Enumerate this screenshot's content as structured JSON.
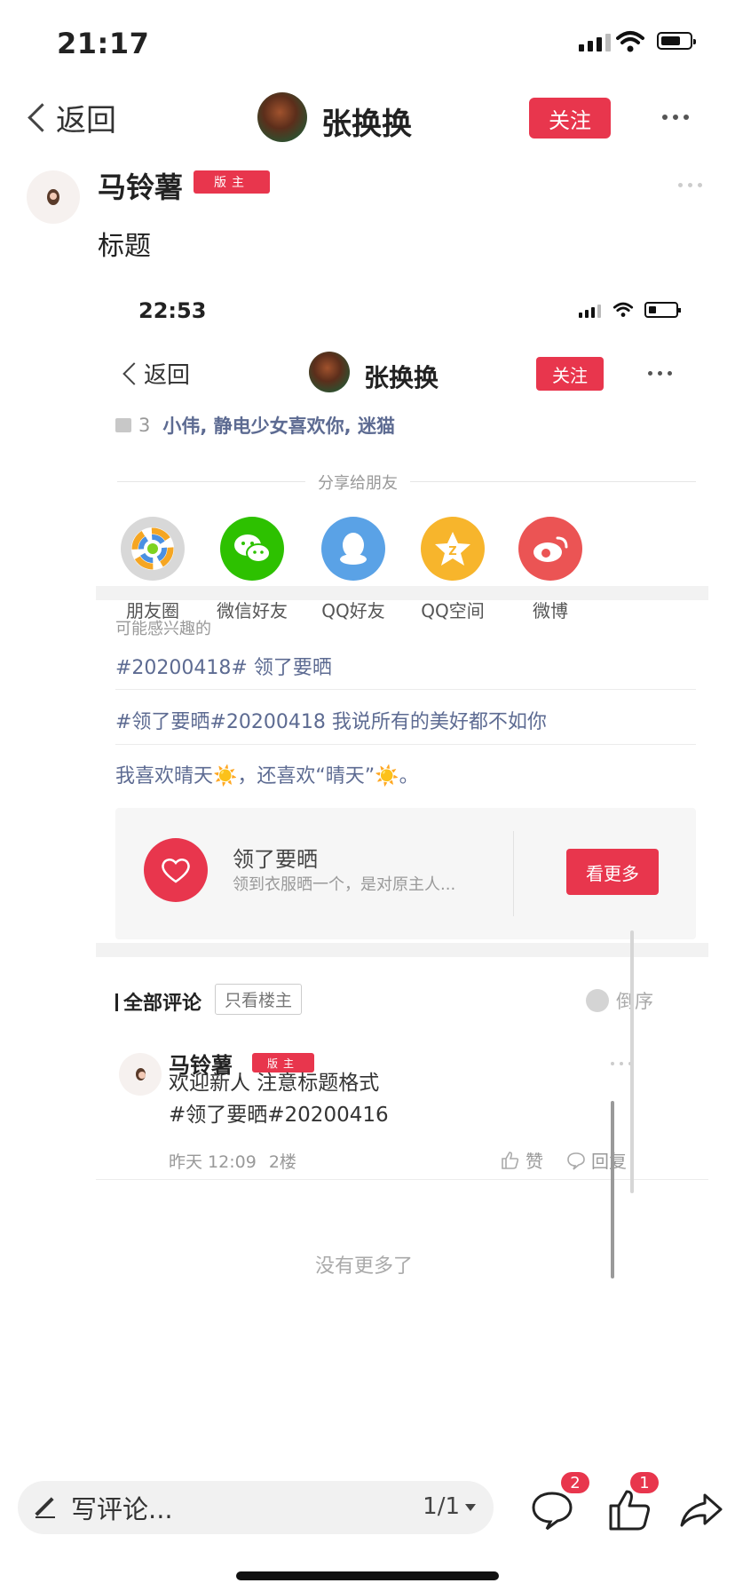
{
  "status_bar": {
    "time": "21:17"
  },
  "header": {
    "back_label": "返回",
    "user_name": "张换换",
    "follow_label": "关注"
  },
  "post": {
    "author": "马铃薯",
    "author_badge": "版主",
    "title": "标题"
  },
  "embedded_screenshot": {
    "status_time": "22:53",
    "back_label": "返回",
    "user_name": "张换换",
    "follow_label": "关注",
    "like_count": "3",
    "liked_by": "小伟, 静电少女喜欢你, 迷猫",
    "share_label": "分享给朋友",
    "share_options": [
      {
        "label": "朋友圈",
        "icon": "moments-icon",
        "color": "#d0d0d0"
      },
      {
        "label": "微信好友",
        "icon": "wechat-icon",
        "color": "#2dc100"
      },
      {
        "label": "QQ好友",
        "icon": "qq-icon",
        "color": "#5aa2e6"
      },
      {
        "label": "QQ空间",
        "icon": "qzone-icon",
        "color": "#f7b52c"
      },
      {
        "label": "微博",
        "icon": "weibo-icon",
        "color": "#eb5454"
      }
    ],
    "maybe_interested_label": "可能感兴趣的",
    "topics": [
      "#20200418# 领了要晒",
      "#领了要晒#20200418 我说所有的美好都不如你",
      "我喜欢晴天☀️，还喜欢“晴天”☀️。"
    ],
    "group_card": {
      "title": "领了要晒",
      "description": "领到衣服晒一个，是对原主人...",
      "button": "看更多"
    },
    "comments_header": "全部评论",
    "only_host_label": "只看楼主",
    "order_label": "倒序",
    "comment": {
      "author": "马铃薯",
      "badge": "版主",
      "text_line1": "欢迎新人 注意标题格式",
      "text_line2": "#领了要晒#20200416",
      "time": "昨天 12:09",
      "floor": "2楼",
      "like_label": "赞",
      "reply_label": "回复"
    },
    "no_more": "没有更多了"
  },
  "bottom_bar": {
    "input_placeholder": "写评论...",
    "page_indicator": "1/1",
    "comment_count": "2",
    "like_count": "1"
  },
  "colors": {
    "accent": "#e8364d",
    "link": "#5d6b92"
  }
}
